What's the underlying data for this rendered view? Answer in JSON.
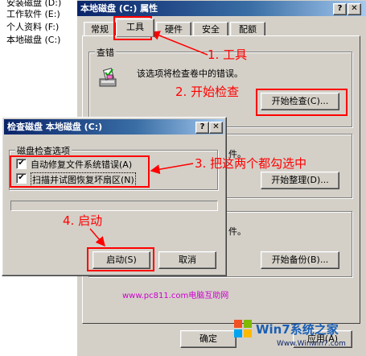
{
  "explorer": {
    "items": [
      {
        "label": "安装磁盘 (D:)"
      },
      {
        "label": "工作软件 (E:)"
      },
      {
        "label": "个人资料 (F:)"
      },
      {
        "label": "本地磁盘 (C:)"
      }
    ]
  },
  "properties": {
    "title": "本地磁盘 (C:) 属性",
    "tabs": [
      "常规",
      "工具",
      "硬件",
      "安全",
      "配额"
    ],
    "active_tab": "工具",
    "check_group": {
      "title": "查错",
      "desc": "该选项将检查卷中的错误。",
      "button": "开始检查(C)..."
    },
    "defrag_group": {
      "desc": "件。",
      "button": "开始整理(D)..."
    },
    "backup_group": {
      "desc": "件。",
      "button": "开始备份(B)..."
    },
    "ok_button": "确定",
    "apply_button": "应用(A)"
  },
  "dialog": {
    "title": "检查磁盘 本地磁盘 (C:)",
    "group_title": "磁盘检查选项",
    "options": [
      {
        "label": "自动修复文件系统错误(A)",
        "checked": true
      },
      {
        "label": "扫描并试图恢复坏扇区(N)",
        "checked": true
      }
    ],
    "start_button": "启动(S)",
    "cancel_button": "取消"
  },
  "annotations": {
    "step1": "1. 工具",
    "step2": "2. 开始检查",
    "step3": "3. 把这两个都勾选中",
    "step4": "4. 启动"
  },
  "watermark": {
    "site": "www.pc811.com电脑互助网",
    "brand": "Win7系统之家",
    "url": "Www.Winwin7.com"
  },
  "colors": {
    "annotation": "#ff0000",
    "title_active": "#0a246a",
    "face": "#d4d0c8"
  }
}
